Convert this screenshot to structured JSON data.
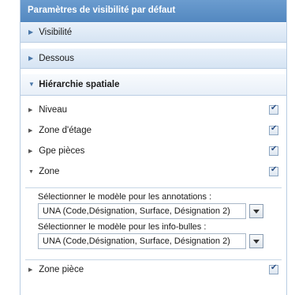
{
  "panel": {
    "title": "Paramètres de visibilité par défaut"
  },
  "sections": {
    "visibilite": "Visibilité",
    "dessous": "Dessous",
    "hierarchie": "Hiérarchie spatiale"
  },
  "hierarchy_items": {
    "niveau": {
      "label": "Niveau",
      "checked": true
    },
    "zone_etage": {
      "label": "Zone d'étage",
      "checked": true
    },
    "gpe_pieces": {
      "label": "Gpe pièces",
      "checked": true
    },
    "zone": {
      "label": "Zone",
      "checked": true,
      "expanded": true
    },
    "zone_piece": {
      "label": "Zone pièce",
      "checked": true
    }
  },
  "zone_settings": {
    "annotations_label": "Sélectionner le modèle pour les annotations :",
    "annotations_value": "UNA (Code,Désignation, Surface, Désignation 2)",
    "tooltips_label": "Sélectionner le modèle pour les info-bulles :",
    "tooltips_value": "UNA (Code,Désignation, Surface, Désignation 2)"
  },
  "colors": {
    "title_bar": "#5b8fc6",
    "section_header": "#dde8f4",
    "border": "#b9cde3"
  },
  "icons": {
    "collapsed": "triangle-right-icon",
    "expanded": "triangle-down-icon",
    "check": "checkbox-checked-icon",
    "dropdown": "dropdown-arrow-icon"
  }
}
